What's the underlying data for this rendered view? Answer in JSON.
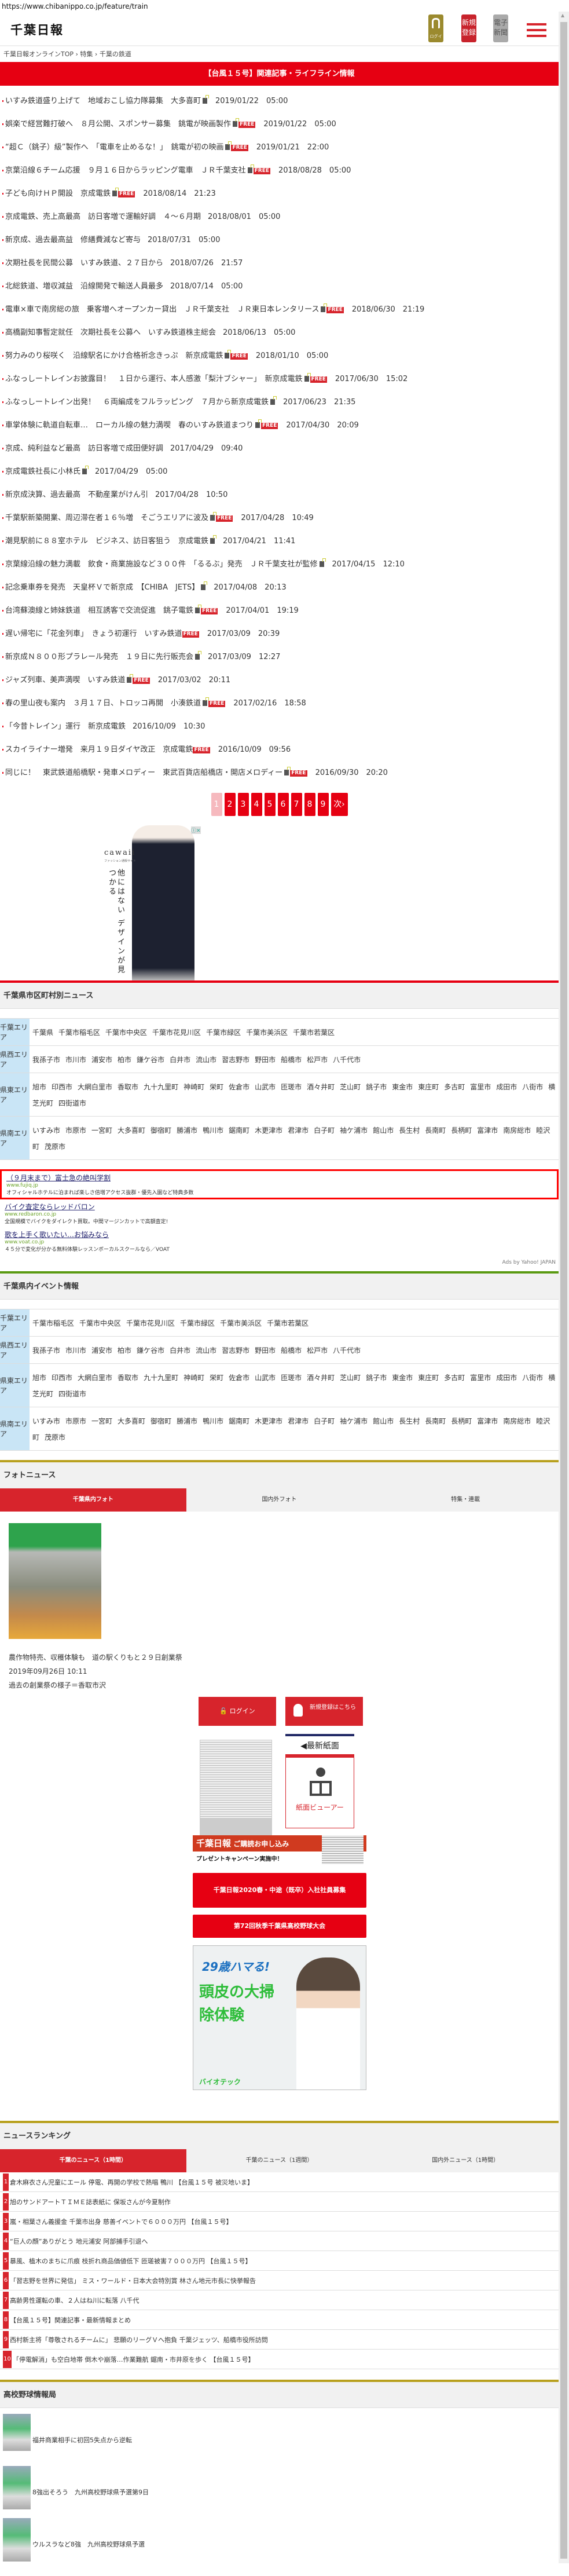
{
  "url": "https://www.chibanippo.co.jp/feature/train",
  "header": {
    "logo": "千葉日報",
    "login_label": "ログイン",
    "register_label": "新規登録",
    "epaper_label": "電子新聞"
  },
  "breadcrumb": [
    "千葉日報オンラインTOP",
    "特集",
    "千葉の鉄道"
  ],
  "breadcrumb_sep": "›",
  "banner": "【台風１５号】関連記事・ライフライン情報",
  "free_label": "FREE",
  "articles": [
    {
      "title": "いすみ鉄道盛り上げて　地域おこし協力隊募集　大多喜町",
      "lock": true,
      "free": false,
      "date": "2019/01/22　05:00"
    },
    {
      "title": "娯楽で経営難打破へ　８月公開、スポンサー募集　銚電が映画製作",
      "lock": true,
      "free": true,
      "date": "2019/01/22　05:00"
    },
    {
      "title": "“超Ｃ（銚子）級”製作へ　「電車を止めるな！」　銚電が初の映画",
      "lock": true,
      "free": true,
      "date": "2019/01/21　22:00"
    },
    {
      "title": "京葉沿線６チーム応援　９月１６日からラッピング電車　ＪＲ千葉支社",
      "lock": true,
      "free": true,
      "date": "2018/08/28　05:00"
    },
    {
      "title": "子ども向けＨＰ開設　京成電鉄",
      "lock": true,
      "free": true,
      "date": "2018/08/14　21:23"
    },
    {
      "title": "京成電鉄、売上高最高　訪日客増で運輸好調　４～６月期",
      "lock": false,
      "free": false,
      "date": "2018/08/01　05:00"
    },
    {
      "title": "新京成、過去最高益　修繕費減など寄与",
      "lock": false,
      "free": false,
      "date": "2018/07/31　05:00"
    },
    {
      "title": "次期社長を民間公募　いすみ鉄道、２７日から",
      "lock": false,
      "free": false,
      "date": "2018/07/26　21:57"
    },
    {
      "title": "北総鉄道、増収減益　沿線開発で輸送人員最多",
      "lock": false,
      "free": false,
      "date": "2018/07/14　05:00"
    },
    {
      "title": "電車×車で南房総の旅　乗客増へオープンカー貸出　ＪＲ千葉支社　ＪＲ東日本レンタリース",
      "lock": true,
      "free": true,
      "date": "2018/06/30　21:19"
    },
    {
      "title": "高橋副知事暫定就任　次期社長を公募へ　いすみ鉄道株主総会",
      "lock": false,
      "free": false,
      "date": "2018/06/13　05:00"
    },
    {
      "title": "努力みのり桜咲く　沿線駅名にかけ合格祈念きっぷ　新京成電鉄",
      "lock": true,
      "free": true,
      "date": "2018/01/10　05:00"
    },
    {
      "title": "ふなっしートレインお披露目！　１日から運行、本人感激「梨汁ブシャー」　新京成電鉄",
      "lock": true,
      "free": true,
      "date": "2017/06/30　15:02"
    },
    {
      "title": "ふなっしートレイン出発！　６両編成をフルラッピング　７月から新京成電鉄",
      "lock": true,
      "free": false,
      "date": "2017/06/23　21:35"
    },
    {
      "title": "車掌体験に軌道自転車…　ローカル線の魅力満喫　春のいすみ鉄道まつり",
      "lock": true,
      "free": true,
      "date": "2017/04/30　20:09"
    },
    {
      "title": "京成、純利益など最高　訪日客増で成田便好調",
      "lock": false,
      "free": false,
      "date": "2017/04/29　09:40"
    },
    {
      "title": "京成電鉄社長に小林氏",
      "lock": true,
      "free": false,
      "date": "2017/04/29　05:00"
    },
    {
      "title": "新京成決算、過去最高　不動産業がけん引",
      "lock": false,
      "free": false,
      "date": "2017/04/28　10:50"
    },
    {
      "title": "千葉駅新築開業、周辺滞在者１６％増　そごうエリアに波及",
      "lock": true,
      "free": true,
      "date": "2017/04/28　10:49"
    },
    {
      "title": "潮見駅前に８８室ホテル　ビジネス、訪日客狙う　京成電鉄",
      "lock": true,
      "free": false,
      "date": "2017/04/21　11:41"
    },
    {
      "title": "京葉線沿線の魅力満載　飲食・商業施設など３００件　「るるぶ」発売　ＪＲ千葉支社が監修",
      "lock": true,
      "free": false,
      "date": "2017/04/15　12:10"
    },
    {
      "title": "記念乗車券を発売　天皇杯Ｖで新京成　【CHIBA　JETS】",
      "lock": true,
      "free": false,
      "date": "2017/04/08　20:13"
    },
    {
      "title": "台湾蘇澳線と姉妹鉄道　相互誘客で交流促進　銚子電鉄",
      "lock": true,
      "free": true,
      "date": "2017/04/01　19:19"
    },
    {
      "title": "遅い帰宅に「花金列車」　きょう初運行　いすみ鉄道",
      "lock": false,
      "free": true,
      "date": "2017/03/09　20:39"
    },
    {
      "title": "新京成Ｎ８００形プラレール発売　１９日に先行販売会",
      "lock": true,
      "free": false,
      "date": "2017/03/09　12:27"
    },
    {
      "title": "ジャズ列車、美声満喫　いすみ鉄道",
      "lock": true,
      "free": true,
      "date": "2017/03/02　20:11"
    },
    {
      "title": "春の里山夜も案内　３月１７日、トロッコ再開　小湊鉄道",
      "lock": true,
      "free": true,
      "date": "2017/02/16　18:58"
    },
    {
      "title": "「今昔トレイン」運行　新京成電鉄",
      "lock": false,
      "free": false,
      "date": "2016/10/09　10:30"
    },
    {
      "title": "スカイライナー増発　来月１９日ダイヤ改正　京成電鉄",
      "lock": false,
      "free": true,
      "date": "2016/10/09　09:56"
    },
    {
      "title": "同じに！　東武鉄道船橋駅・発車メロディー　東武百貨店船橋店・開店メロディー",
      "lock": true,
      "free": true,
      "date": "2016/09/30　20:20"
    }
  ],
  "pagination": {
    "pages": [
      "1",
      "2",
      "3",
      "4",
      "5",
      "6",
      "7",
      "8",
      "9"
    ],
    "current": "1",
    "next": "次›"
  },
  "ad_fashion": {
    "brand": "cawaii",
    "sub": "ファッション通販サイト",
    "copy": "他にはない デザインが見つかる"
  },
  "municipal": {
    "title": "千葉県市区町村別ニュース",
    "areas": [
      {
        "label": "千葉エリア",
        "cities": [
          "千葉県",
          "千葉市稲毛区",
          "千葉市中央区",
          "千葉市花見川区",
          "千葉市緑区",
          "千葉市美浜区",
          "千葉市若葉区"
        ]
      },
      {
        "label": "県西エリア",
        "cities": [
          "我孫子市",
          "市川市",
          "浦安市",
          "柏市",
          "鎌ケ谷市",
          "白井市",
          "流山市",
          "習志野市",
          "野田市",
          "船橋市",
          "松戸市",
          "八千代市"
        ]
      },
      {
        "label": "県東エリア",
        "cities": [
          "旭市",
          "印西市",
          "大網白里市",
          "香取市",
          "九十九里町",
          "神崎町",
          "栄町",
          "佐倉市",
          "山武市",
          "匝瑳市",
          "酒々井町",
          "芝山町",
          "銚子市",
          "東金市",
          "東庄町",
          "多古町",
          "富里市",
          "成田市",
          "八街市",
          "横芝光町",
          "四街道市"
        ]
      },
      {
        "label": "県南エリア",
        "cities": [
          "いすみ市",
          "市原市",
          "一宮町",
          "大多喜町",
          "御宿町",
          "勝浦市",
          "鴨川市",
          "鋸南町",
          "木更津市",
          "君津市",
          "白子町",
          "袖ケ浦市",
          "館山市",
          "長生村",
          "長南町",
          "長柄町",
          "富津市",
          "南房総市",
          "睦沢町",
          "茂原市"
        ]
      }
    ]
  },
  "text_ads": [
    {
      "title": "（９月末まで）富士急の絶叫学割",
      "url": "www.fujiq.jp",
      "desc": "オフィシャルホテルに泊まれば楽しさ倍増アクセス抜群・優先入園など特典多数"
    },
    {
      "title": "バイク査定ならレッドバロン",
      "url": "www.redbaron.co.jp",
      "desc": "全国規模でバイクをダイレクト買取。中間マージンカットで高額査定!"
    },
    {
      "title": "歌を上手く歌いたい…お悩みなら",
      "url": "www.voat.co.jp",
      "desc": "４５分で変化が分かる無料体験レッスンボーカルスクールなら／VOAT"
    }
  ],
  "ads_by": "Ads by Yahoo! JAPAN",
  "events": {
    "title": "千葉県内イベント情報",
    "areas": [
      {
        "label": "千葉エリア",
        "cities": [
          "千葉市稲毛区",
          "千葉市中央区",
          "千葉市花見川区",
          "千葉市緑区",
          "千葉市美浜区",
          "千葉市若葉区"
        ]
      },
      {
        "label": "県西エリア",
        "cities": [
          "我孫子市",
          "市川市",
          "浦安市",
          "柏市",
          "鎌ケ谷市",
          "白井市",
          "流山市",
          "習志野市",
          "野田市",
          "船橋市",
          "松戸市",
          "八千代市"
        ]
      },
      {
        "label": "県東エリア",
        "cities": [
          "旭市",
          "印西市",
          "大網白里市",
          "香取市",
          "九十九里町",
          "神崎町",
          "栄町",
          "佐倉市",
          "山武市",
          "匝瑳市",
          "酒々井町",
          "芝山町",
          "銚子市",
          "東金市",
          "東庄町",
          "多古町",
          "富里市",
          "成田市",
          "八街市",
          "横芝光町",
          "四街道市"
        ]
      },
      {
        "label": "県南エリア",
        "cities": [
          "いすみ市",
          "市原市",
          "一宮町",
          "大多喜町",
          "御宿町",
          "勝浦市",
          "鴨川市",
          "鋸南町",
          "木更津市",
          "君津市",
          "白子町",
          "袖ケ浦市",
          "館山市",
          "長生村",
          "長南町",
          "長柄町",
          "富津市",
          "南房総市",
          "睦沢町",
          "茂原市"
        ]
      }
    ]
  },
  "photo_news": {
    "title": "フォトニュース",
    "tabs": [
      "千葉県内フォト",
      "国内外フォト",
      "特集・連載"
    ],
    "headline": "農作物特売、収穫体験も　道の駅くりもと２９日創業祭",
    "date": "2019年09月26日 10:11",
    "caption": "過去の創業祭の様子＝香取市沢"
  },
  "side": {
    "login": "ログイン",
    "register": "新規登録はこちら",
    "latest": "◀最新紙面",
    "viewer": "紙面ビューアー",
    "subscribe_logo": "千葉日報",
    "subscribe": "ご購読お申し込み",
    "campaign": "プレゼントキャンペーン実施中！",
    "recruit": "千葉日報2020春・中途（既卒）入社社員募集",
    "baseball_tournament": "第72回秋季千葉県高校野球大会",
    "ad": {
      "line1": "29歳ハマる!",
      "line2": "頭皮の大掃除体験",
      "brand": "バイオテック"
    }
  },
  "ranking": {
    "title": "ニュースランキング",
    "tabs": [
      "千葉のニュース（1時間）",
      "千葉のニュース（1週間）",
      "国内外ニュース（1時間）"
    ],
    "items": [
      "倉木麻衣さん児童にエール 停電、再開の学校で熱唱 鴨川 【台風１５号 被災地いま】",
      "旭のサンドアートＴＩＭＥ誌表紙に 保坂さんが今夏制作",
      "嵐・相葉さん義援金 千葉市出身 慈善イベントで６０００万円 【台風１５号】",
      "“巨人の顔”ありがとう 地元浦安 阿部捕手引退へ",
      "暴風、植木のまちに爪痕 枝折れ商品価値低下 匝瑳被害７０００万円 【台風１５号】",
      "「習志野を世界に発信」 ミス・ワールド・日本大会特別賞 林さん地元市長に快挙報告",
      "高齢男性運転の車、２人はね川に転落 八千代",
      "【台風１５号】関連記事・最新情報まとめ",
      "西村新主将「尊敬されるチームに」 悲願のリーグＶへ抱負 千葉ジェッツ、船橋市役所訪問",
      "「停電解消」も空白地帯 倒木や崩落…作業難航 鋸南・市井原を歩く 【台風１５号】"
    ]
  },
  "baseball": {
    "title": "高校野球情報局",
    "items": [
      "福井商業相手に初回5失点から逆転",
      "8強出そろう　九州高校野球県予選第9日",
      "ウルスラなど8強　九州高校野球県予選"
    ]
  }
}
